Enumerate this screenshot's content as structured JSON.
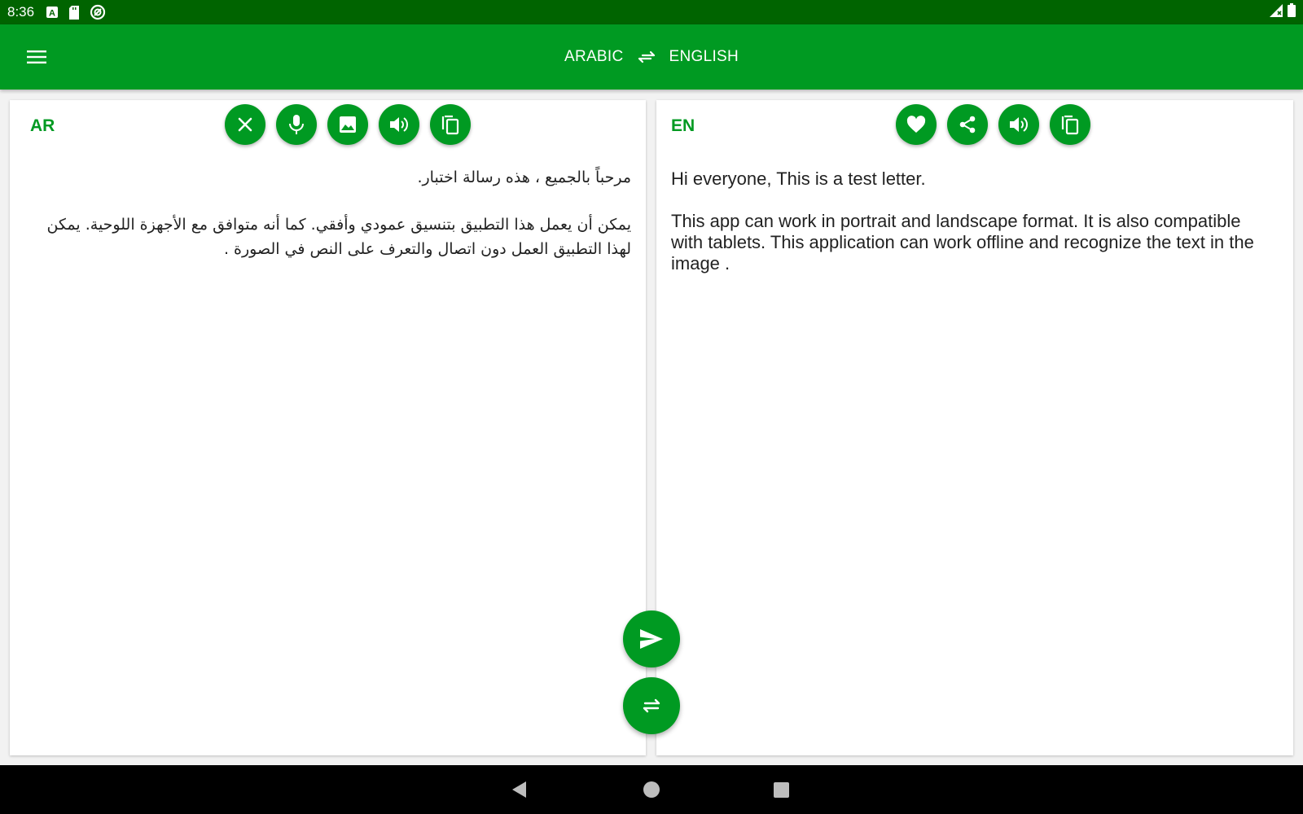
{
  "status_bar": {
    "time": "8:36",
    "icons_left": [
      "a-notification-icon",
      "sd-card-icon",
      "sync-icon"
    ],
    "icons_right": [
      "signal-icon",
      "battery-icon"
    ]
  },
  "toolbar": {
    "menu_icon": "hamburger-menu-icon",
    "source_lang": "ARABIC",
    "target_lang": "ENGLISH",
    "swap_icon": "swap-arrows-icon"
  },
  "source_panel": {
    "code": "AR",
    "actions": [
      "close-icon",
      "microphone-icon",
      "image-icon",
      "speaker-icon",
      "copy-icon"
    ],
    "paragraphs": [
      "مرحباً بالجميع ، هذه رسالة اختبار.",
      "يمكن أن يعمل هذا التطبيق بتنسيق عمودي وأفقي. كما أنه متوافق مع الأجهزة اللوحية. يمكن لهذا التطبيق العمل دون اتصال والتعرف على النص في الصورة ."
    ]
  },
  "target_panel": {
    "code": "EN",
    "actions": [
      "heart-icon",
      "share-icon",
      "speaker-icon",
      "copy-icon"
    ],
    "paragraphs": [
      "Hi everyone, This is a test letter.",
      "This app can work in portrait and landscape format. It is also compatible with tablets. This application can work offline and recognize the text in the image ."
    ]
  },
  "fabs": {
    "send_icon": "send-icon",
    "swap_icon": "swap-icon"
  },
  "nav_bar": {
    "items": [
      "back-icon",
      "home-icon",
      "recents-icon"
    ]
  },
  "colors": {
    "status_bar": "#006400",
    "toolbar": "#009a22",
    "accent": "#009a22",
    "nav_bar": "#000000"
  }
}
